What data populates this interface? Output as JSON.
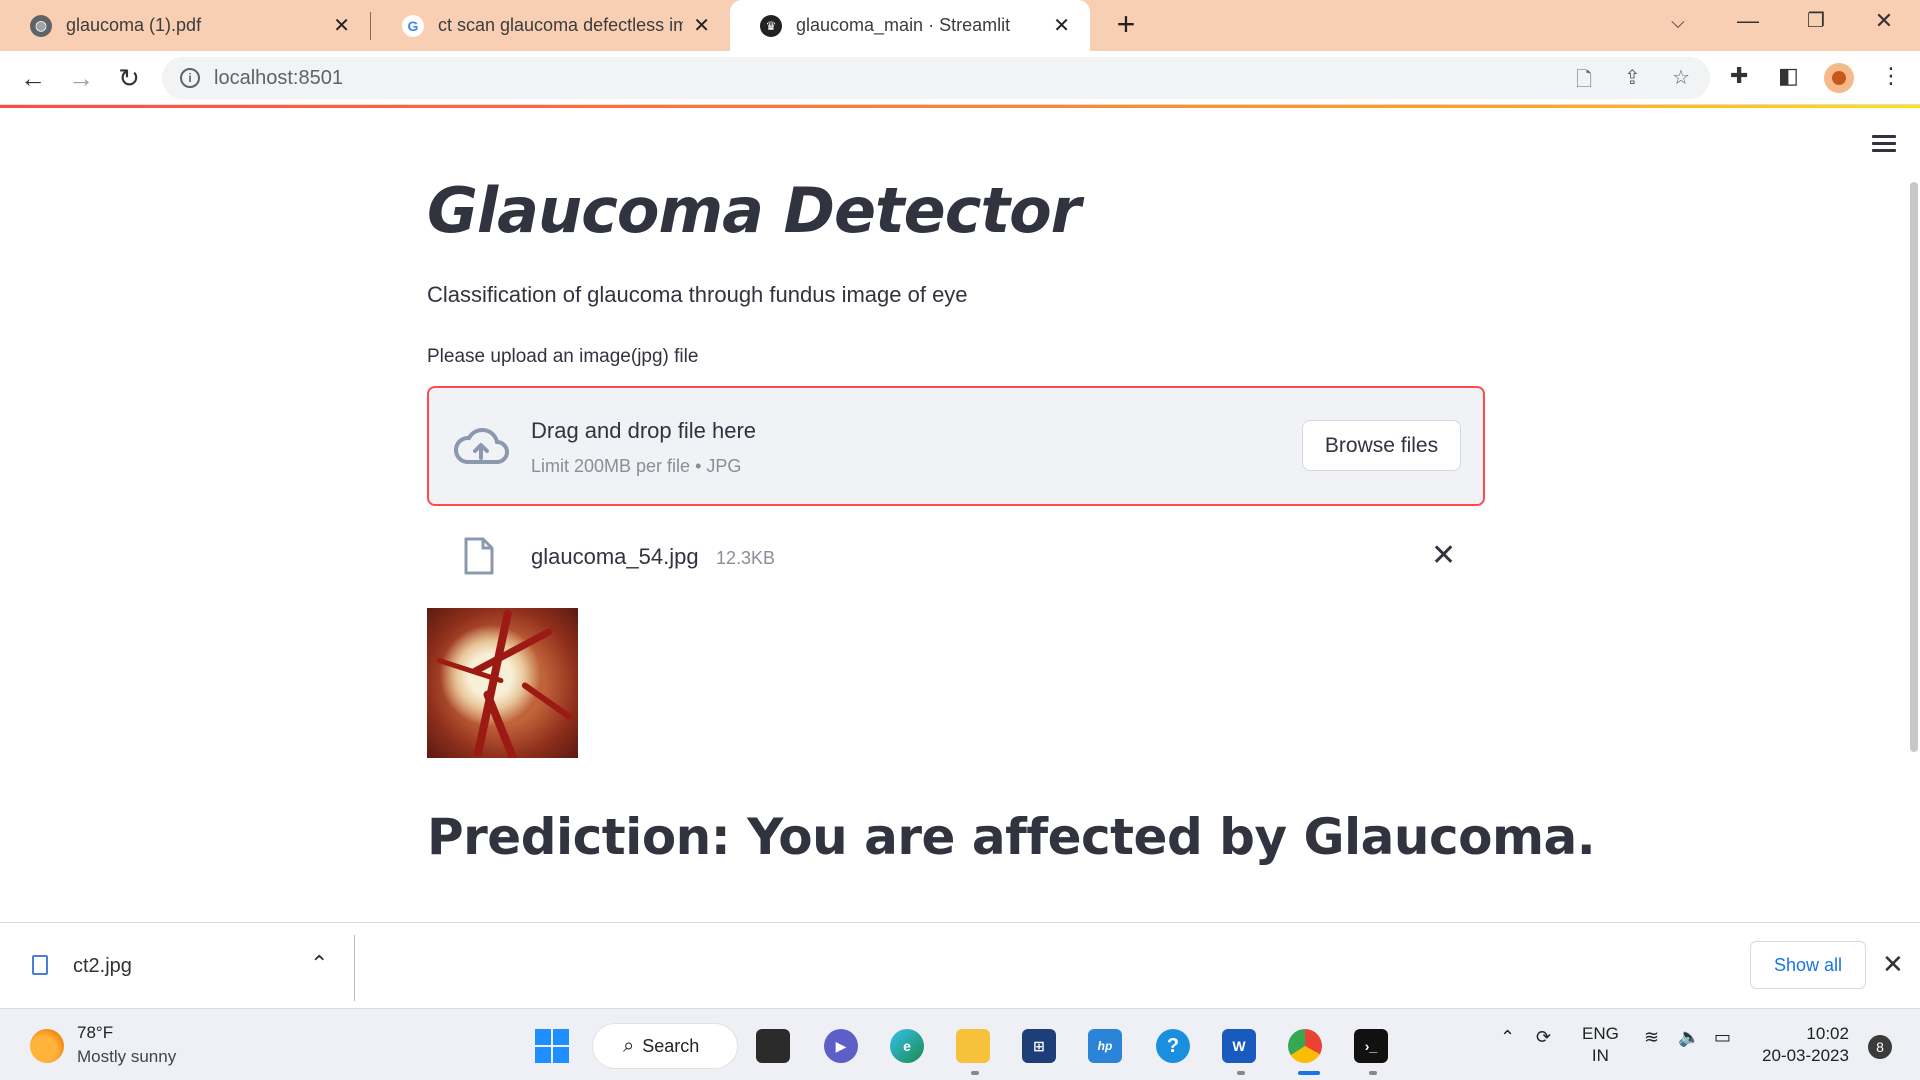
{
  "browser": {
    "tabs": [
      {
        "title": "glaucoma (1).pdf",
        "icon": "globe-icon",
        "active": false
      },
      {
        "title": "ct scan glaucoma defectless imag",
        "icon": "google-icon",
        "active": false
      },
      {
        "title": "glaucoma_main · Streamlit",
        "icon": "streamlit-icon",
        "active": true
      }
    ],
    "url": "localhost:8501",
    "accent": "#f9cfb4"
  },
  "app": {
    "title": "Glaucoma Detector",
    "subtitle": "Classification of glaucoma through fundus image of eye",
    "uploader": {
      "label": "Please upload an image(jpg) file",
      "drag_text": "Drag and drop file here",
      "limit_text": "Limit 200MB per file • JPG",
      "browse_label": "Browse files"
    },
    "uploaded_file": {
      "name": "glaucoma_54.jpg",
      "size": "12.3KB"
    },
    "prediction": "Prediction: You are affected by Glaucoma.",
    "accent": "#ff4b4b"
  },
  "downloads": {
    "file": "ct2.jpg",
    "show_all": "Show all"
  },
  "taskbar": {
    "weather_temp": "78°F",
    "weather_condition": "Mostly sunny",
    "search_label": "Search",
    "lang_line1": "ENG",
    "lang_line2": "IN",
    "time": "10:02",
    "date": "20-03-2023",
    "notification_count": "8"
  }
}
